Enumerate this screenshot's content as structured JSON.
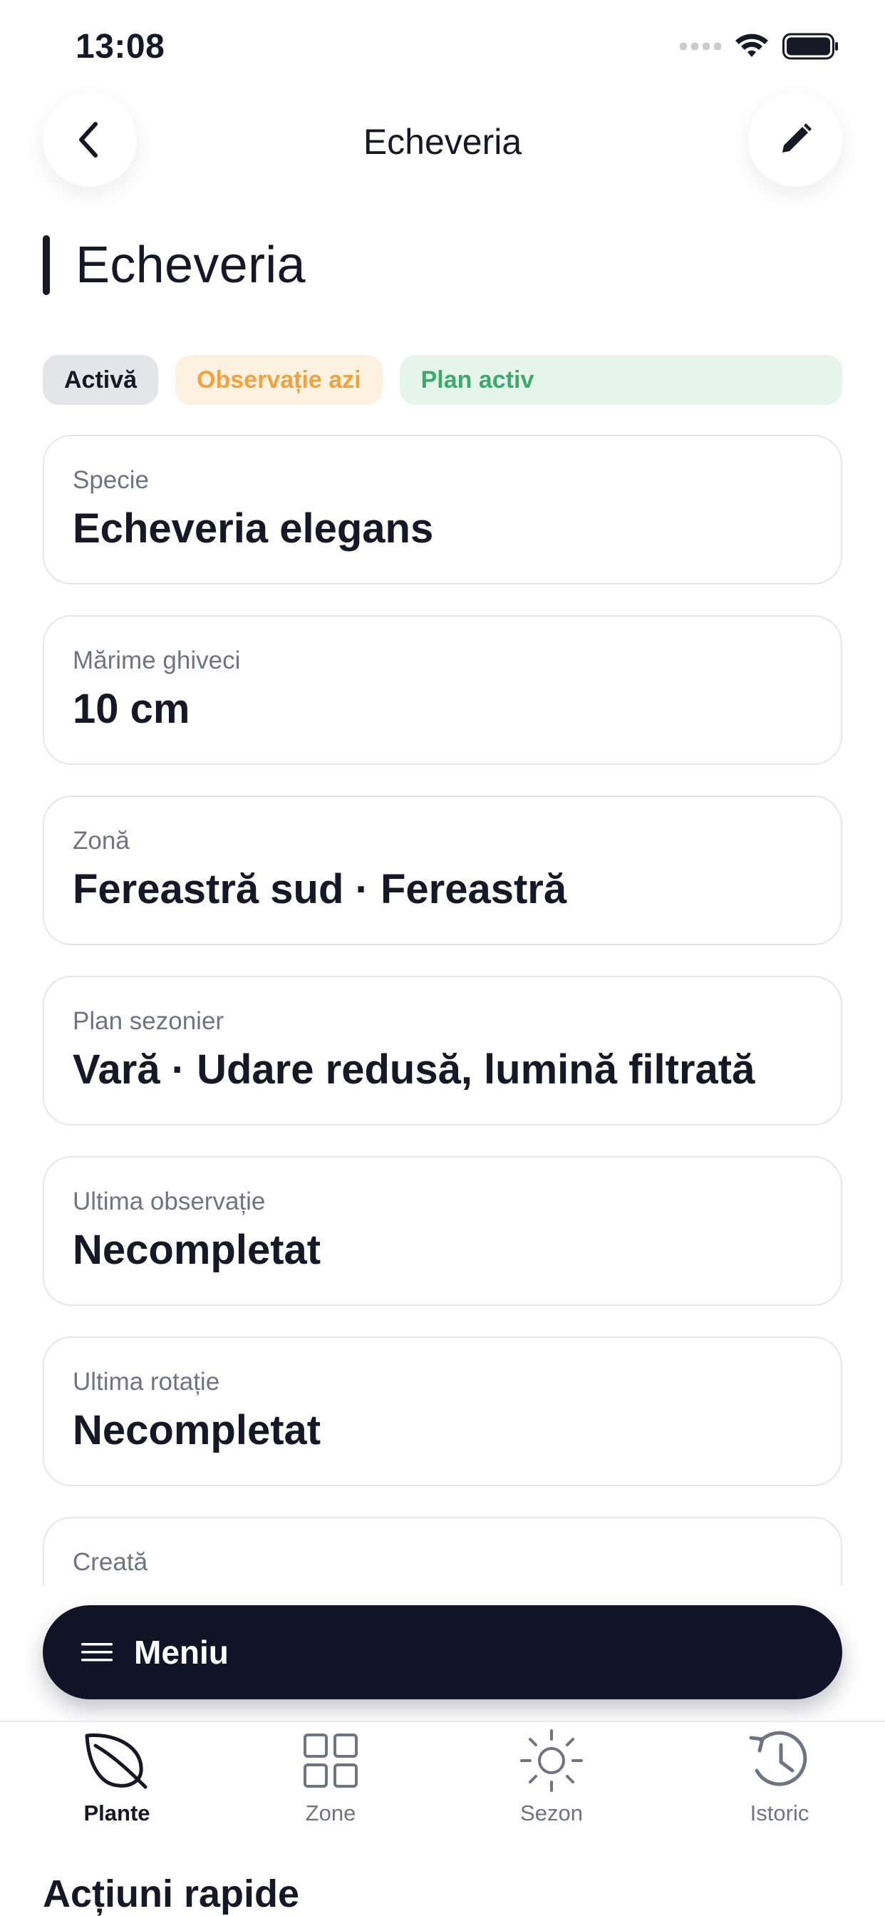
{
  "status_bar": {
    "time": "13:08"
  },
  "header": {
    "title": "Echeveria",
    "back_icon": "chevron-left-icon",
    "edit_icon": "pencil-icon"
  },
  "page": {
    "title": "Echeveria"
  },
  "badges": [
    {
      "label": "Activă",
      "color": "#161826",
      "background": "#e4e5e8"
    },
    {
      "label": "Observație azi",
      "color": "#efa23d",
      "background": "#fdf1e0"
    },
    {
      "label": "Plan activ",
      "color": "#3daa6c",
      "background": "#e6f5ec"
    }
  ],
  "details": [
    {
      "label": "Specie",
      "value": "Echeveria elegans"
    },
    {
      "label": "Mărime ghiveci",
      "value": "10 cm"
    },
    {
      "label": "Zonă",
      "value": "Fereastră sud · Fereastră"
    },
    {
      "label": "Plan sezonier",
      "value": "Vară · Udare redusă, lumină filtrată"
    },
    {
      "label": "Ultima observație",
      "value": "Necompletat"
    },
    {
      "label": "Ultima rotație",
      "value": "Necompletat"
    },
    {
      "label": "Creată",
      "value": ""
    }
  ],
  "menu": {
    "label": "Meniu",
    "icon": "hamburger-icon"
  },
  "tabs": [
    {
      "label": "Plante",
      "icon": "leaf-icon",
      "active": true
    },
    {
      "label": "Zone",
      "icon": "grid-icon",
      "active": false
    },
    {
      "label": "Sezon",
      "icon": "sun-icon",
      "active": false
    },
    {
      "label": "Istoric",
      "icon": "history-icon",
      "active": false
    }
  ],
  "quick_actions": {
    "title": "Acțiuni rapide"
  },
  "colors": {
    "primary_dark": "#111326",
    "text": "#161826",
    "muted": "#6f7480",
    "border": "#e5e6ea"
  }
}
